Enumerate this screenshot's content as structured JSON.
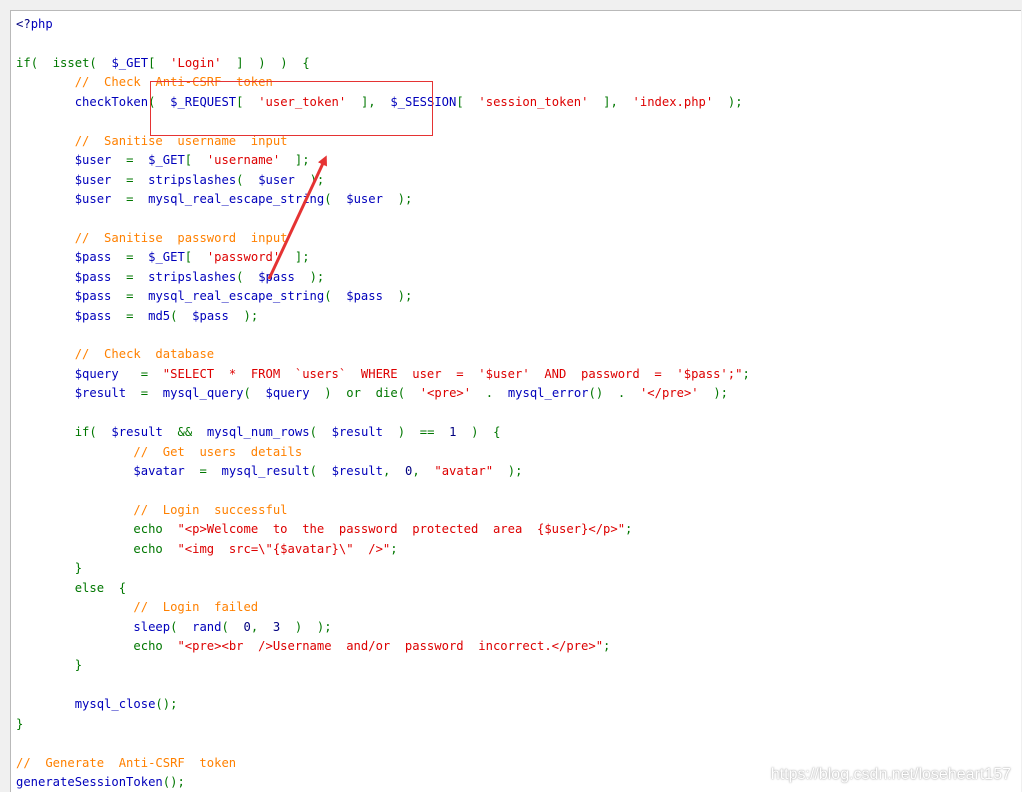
{
  "colors": {
    "comment": "#ff8000",
    "string": "#dd0000",
    "keyword": "#007700",
    "default": "#0000bb",
    "annotation": "#e53333"
  },
  "watermark": "https://blog.csdn.net/loseheart157",
  "code_lines": [
    "<?php",
    "",
    "if(  isset(  $_GET[  'Login'  ]  )  )  {",
    "        //  Check  Anti-CSRF  token",
    "        checkToken(  $_REQUEST[  'user_token'  ],  $_SESSION[  'session_token'  ],  'index.php'  );",
    "",
    "        //  Sanitise  username  input",
    "        $user  =  $_GET[  'username'  ];",
    "        $user  =  stripslashes(  $user  );",
    "        $user  =  mysql_real_escape_string(  $user  );",
    "",
    "        //  Sanitise  password  input",
    "        $pass  =  $_GET[  'password'  ];",
    "        $pass  =  stripslashes(  $pass  );",
    "        $pass  =  mysql_real_escape_string(  $pass  );",
    "        $pass  =  md5(  $pass  );",
    "",
    "        //  Check  database",
    "        $query   =  \"SELECT  *  FROM  `users`  WHERE  user  =  '$user'  AND  password  =  '$pass';\";",
    "        $result  =  mysql_query(  $query  )  or  die(  '<pre>'  .  mysql_error()  .  '</pre>'  );",
    "",
    "        if(  $result  &&  mysql_num_rows(  $result  )  ==  1  )  {",
    "                //  Get  users  details",
    "                $avatar  =  mysql_result(  $result,  0,  \"avatar\"  );",
    "",
    "                //  Login  successful",
    "                echo  \"<p>Welcome  to  the  password  protected  area  {$user}</p>\";",
    "                echo  \"<img  src=\\\"{$avatar}\\\"  />\";",
    "        }",
    "        else  {",
    "                //  Login  failed",
    "                sleep(  rand(  0,  3  )  );",
    "                echo  \"<pre><br  />Username  and/or  password  incorrect.</pre>\";",
    "        }",
    "",
    "        mysql_close();",
    "}",
    "",
    "//  Generate  Anti-CSRF  token",
    "generateSessionToken();"
  ]
}
